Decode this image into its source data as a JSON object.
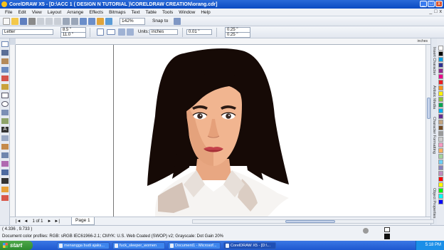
{
  "window": {
    "title": "CorelDRAW X5 - [D:\\ACC 1 ( DESIGN N TUTORIAL )\\CORELDRAW CREATION\\orang.cdr]",
    "minimize": "_",
    "maximize": "□",
    "close": "x"
  },
  "menu": {
    "items": [
      "File",
      "Edit",
      "View",
      "Layout",
      "Arrange",
      "Effects",
      "Bitmaps",
      "Text",
      "Table",
      "Tools",
      "Window",
      "Help"
    ],
    "doc_controls": [
      "_",
      "□",
      "x"
    ]
  },
  "standard_toolbar": {
    "zoom_value": "142%",
    "snap_to_label": "Snap to"
  },
  "property_bar": {
    "paper_size": "Letter",
    "width": "8.5 \"",
    "height": "11.0 \"",
    "units_label": "Units:",
    "units_value": "inches",
    "nudge": "0.01 \"",
    "dup_x": "0.25 \"",
    "dup_y": "0.25 \""
  },
  "ruler": {
    "units": "inches"
  },
  "dockers": {
    "tabs": [
      "Object Properties",
      "Character Formatting",
      "Artistic Media",
      "Insert Character"
    ]
  },
  "palette": {
    "colors": [
      "#ffffff",
      "#000000",
      "#00a0e3",
      "#2e3192",
      "#92278f",
      "#ec008c",
      "#ed1c24",
      "#f7941d",
      "#fff200",
      "#8dc63f",
      "#00a651",
      "#00aeef",
      "#662d91",
      "#c2a47f",
      "#754c24",
      "#999999",
      "#cccccc",
      "#f49ac1",
      "#fbaf5d",
      "#a3d39c",
      "#6dcff6",
      "#8781bd",
      "#bd8cbf",
      "#ff0000",
      "#ffff00",
      "#00ff00",
      "#00ffff",
      "#0000ff"
    ]
  },
  "page_nav": {
    "page_count": "1 of 1",
    "page_tab": "Page 1"
  },
  "status": {
    "coords": "( 4.336 , 9.733 )",
    "color_profiles": "Document color profiles: RGB: sRGB IEC61966-2.1; CMYK: U.S. Web Coated (SWOP) v2; Grayscale: Dot Gain 20%"
  },
  "taskbar": {
    "start_label": "start",
    "tasks": [
      "menangga budi ajaks...",
      "fuck_sleeper_women",
      "Document1 - Microsof...",
      "CorelDRAW X5 - [D:\\..."
    ],
    "clock": "5:18 PM"
  }
}
